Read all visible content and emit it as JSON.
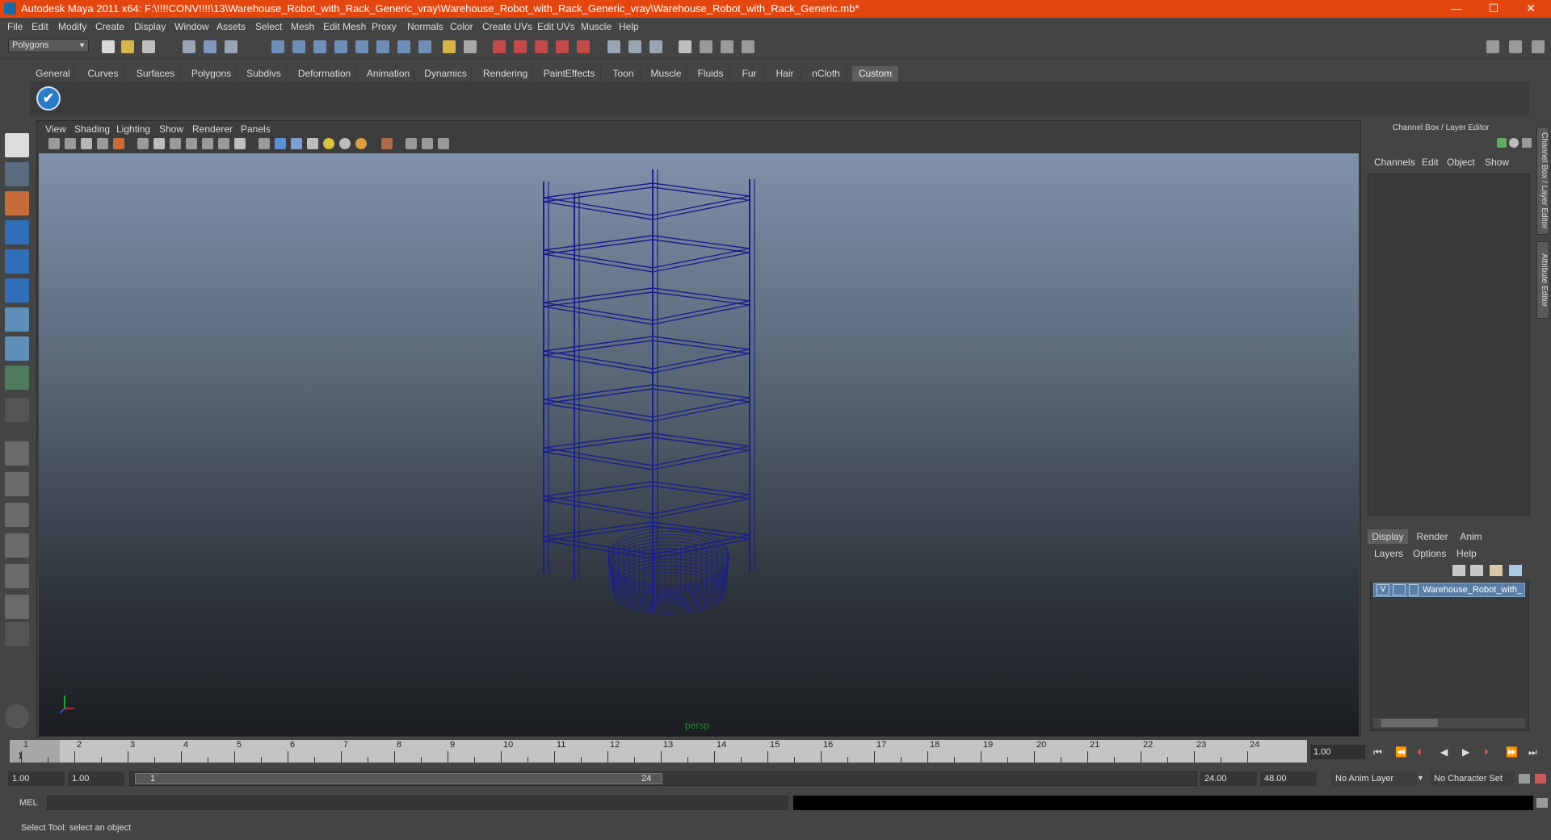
{
  "window": {
    "title": "Autodesk Maya 2011 x64: F:\\!!!!CONV!!!!\\13\\Warehouse_Robot_with_Rack_Generic_vray\\Warehouse_Robot_with_Rack_Generic_vray\\Warehouse_Robot_with_Rack_Generic.mb*",
    "minimize": "—",
    "maximize": "☐",
    "close": "✕"
  },
  "menubar": [
    "File",
    "Edit",
    "Modify",
    "Create",
    "Display",
    "Window",
    "Assets",
    "Select",
    "Mesh",
    "Edit Mesh",
    "Proxy",
    "Normals",
    "Color",
    "Create UVs",
    "Edit UVs",
    "Muscle",
    "Help"
  ],
  "statusline": {
    "mode": "Polygons"
  },
  "shelf": {
    "tabs": [
      "General",
      "Curves",
      "Surfaces",
      "Polygons",
      "Subdivs",
      "Deformation",
      "Animation",
      "Dynamics",
      "Rendering",
      "PaintEffects",
      "Toon",
      "Muscle",
      "Fluids",
      "Fur",
      "Hair",
      "nCloth",
      "Custom"
    ],
    "active_tab": "Custom",
    "check_icon": "✔"
  },
  "viewport": {
    "menu": [
      "View",
      "Shading",
      "Lighting",
      "Show",
      "Renderer",
      "Panels"
    ],
    "camera_label": "persp",
    "wire_color": "#1a1f8c"
  },
  "channelbox": {
    "title": "Channel Box / Layer Editor",
    "menu": [
      "Channels",
      "Edit",
      "Object",
      "Show"
    ]
  },
  "side_tabs": [
    "Channel Box / Layer Editor",
    "Attribute Editor"
  ],
  "layereditor": {
    "tabs": [
      "Display",
      "Render",
      "Anim"
    ],
    "active_tab": "Display",
    "menu": [
      "Layers",
      "Options",
      "Help"
    ],
    "layer": {
      "visible": "V",
      "name": "Warehouse_Robot_with_"
    }
  },
  "timeline": {
    "ticks": [
      "1",
      "2",
      "3",
      "4",
      "5",
      "6",
      "7",
      "8",
      "9",
      "10",
      "11",
      "12",
      "13",
      "14",
      "15",
      "16",
      "17",
      "18",
      "19",
      "20",
      "21",
      "22",
      "23",
      "24"
    ],
    "current_frame_marker": "1",
    "current_frame": "1.00"
  },
  "range": {
    "start_time": "1.00",
    "playback_start": "1.00",
    "range_start": "1",
    "range_end": "24",
    "playback_end": "24.00",
    "end_time": "48.00",
    "anim_layer": "No Anim Layer",
    "character_set": "No Character Set"
  },
  "cmdline": {
    "label": "MEL"
  },
  "helpline": {
    "text": "Select Tool: select an object"
  },
  "colors": {
    "title_bar": "#e4460f",
    "accent": "#5a7fa6"
  }
}
